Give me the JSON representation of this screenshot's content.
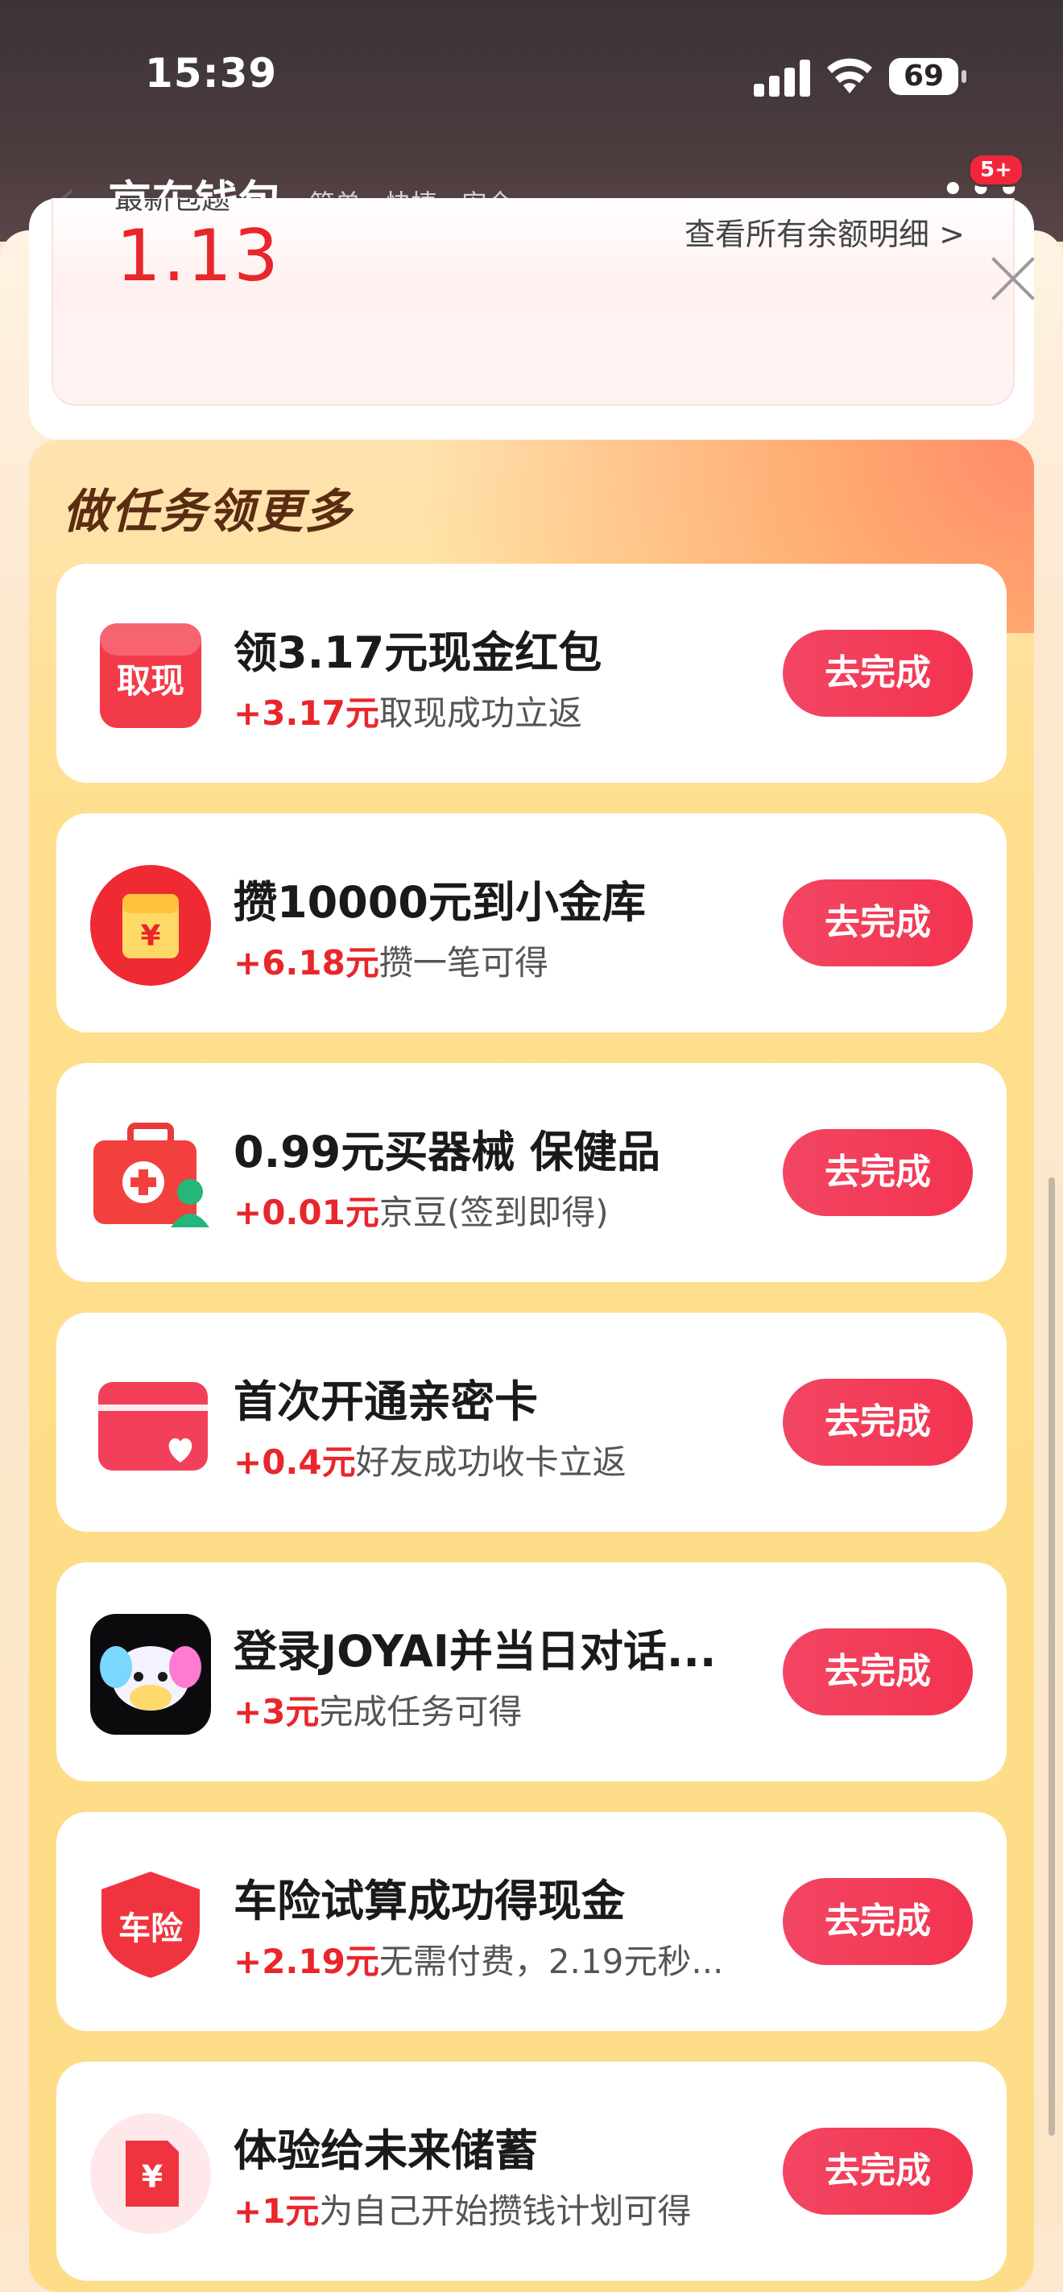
{
  "status_bar": {
    "time": "15:39",
    "battery": "69"
  },
  "header": {
    "title": "京东钱包",
    "subtitle": "简单 · 快捷 · 安全",
    "notification_badge": "5+"
  },
  "balance": {
    "label": "最新包题",
    "value": "1.13",
    "details_link": "查看所有余额明细 >"
  },
  "tasks_section": {
    "title": "做任务领更多",
    "items": [
      {
        "title": "领3.17元现金红包",
        "amount": "+3.17元",
        "desc": "取现成功立返",
        "button": "去完成",
        "icon": "cash-withdraw-icon",
        "icon_text": "取现"
      },
      {
        "title": "攒10000元到小金库",
        "amount": "+6.18元",
        "desc": "攒一笔可得",
        "button": "去完成",
        "icon": "red-envelope-icon",
        "icon_text": "¥"
      },
      {
        "title": "0.99元买器械 保健品",
        "amount": "+0.01元",
        "desc": "京豆(签到即得)",
        "button": "去完成",
        "icon": "medical-kit-icon",
        "icon_text": ""
      },
      {
        "title": "首次开通亲密卡",
        "amount": "+0.4元",
        "desc": "好友成功收卡立返",
        "button": "去完成",
        "icon": "heart-card-icon",
        "icon_text": ""
      },
      {
        "title": "登录JOYAI并当日对话...",
        "amount": "+3元",
        "desc": "完成任务可得",
        "button": "去完成",
        "icon": "joyai-dog-icon",
        "icon_text": ""
      },
      {
        "title": "车险试算成功得现金",
        "amount": "+2.19元",
        "desc": "无需付费，2.19元秒...",
        "button": "去完成",
        "icon": "car-insurance-shield-icon",
        "icon_text": "车险"
      },
      {
        "title": "体验给未来储蓄",
        "amount": "+1元",
        "desc": "为自己开始攒钱计划可得",
        "button": "去完成",
        "icon": "savings-doc-icon",
        "icon_text": "¥"
      }
    ]
  },
  "colors": {
    "accent_red": "#e8262b",
    "button_red": "#f3334f",
    "title_brown": "#5a2c12"
  }
}
